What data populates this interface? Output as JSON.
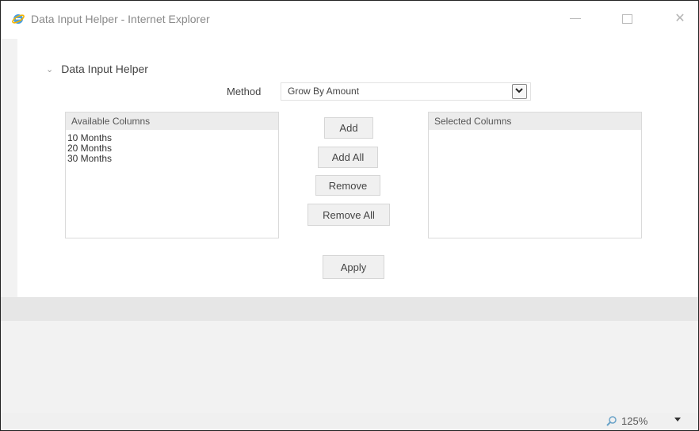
{
  "window": {
    "title": "Data Input Helper - Internet Explorer",
    "app_icon": "internet-explorer-icon",
    "controls": {
      "minimize": "minimize-icon",
      "maximize": "maximize-icon",
      "close": "✕"
    }
  },
  "helper": {
    "section_title": "Data Input Helper",
    "collapse_icon": "chevron-down-icon",
    "method_label": "Method",
    "method_value": "Grow By Amount",
    "available_header": "Available Columns",
    "available_items": [
      "10 Months",
      "20 Months",
      "30 Months"
    ],
    "selected_header": "Selected Columns",
    "selected_items": [],
    "buttons": {
      "add": "Add",
      "add_all": "Add All",
      "remove": "Remove",
      "remove_all": "Remove All",
      "apply": "Apply"
    }
  },
  "statusbar": {
    "zoom_icon": "zoom-icon",
    "zoom_level": "125%"
  },
  "colors": {
    "panel_bg": "#ffffff",
    "window_bg": "#f2f2f2",
    "list_header_bg": "#ececec",
    "button_bg": "#f0f0f0"
  }
}
